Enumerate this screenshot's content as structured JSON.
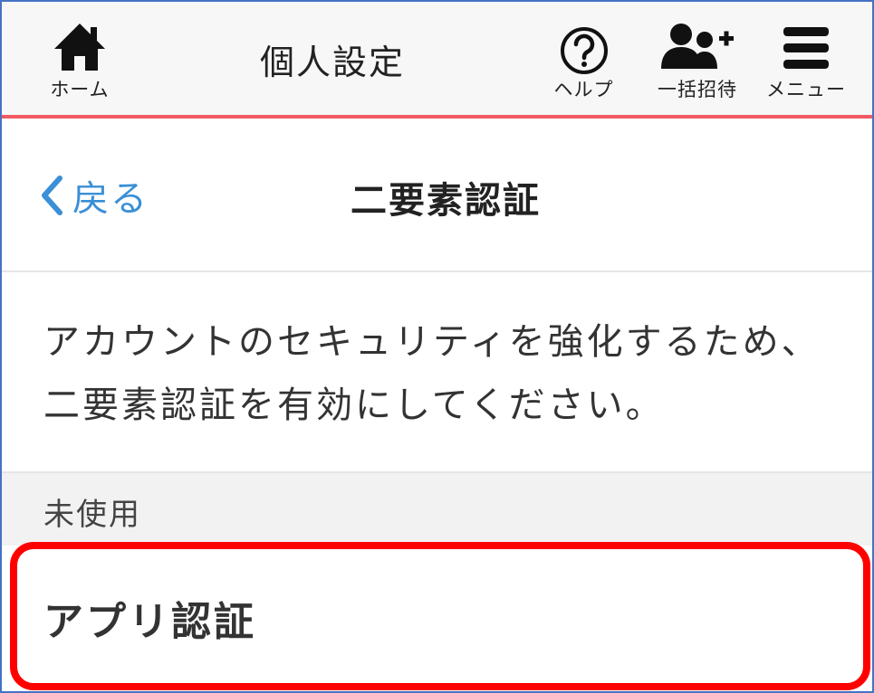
{
  "header": {
    "title": "個人設定",
    "home": {
      "label": "ホーム",
      "icon": "home-icon"
    },
    "help": {
      "label": "ヘルプ",
      "icon": "help-circle-icon"
    },
    "invite": {
      "label": "一括招待",
      "icon": "users-add-icon"
    },
    "menu": {
      "label": "メニュー",
      "icon": "hamburger-menu-icon"
    }
  },
  "nav": {
    "back_label": "戻る",
    "title": "二要素認証"
  },
  "description": "アカウントのセキュリティを強化するため、二要素認証を有効にしてください。",
  "section": {
    "label": "未使用"
  },
  "items": [
    {
      "label": "アプリ認証"
    }
  ],
  "colors": {
    "accent_line": "#f25b63",
    "back_link": "#3a8fd6",
    "highlight": "#ff0000",
    "frame": "#4472c4"
  }
}
